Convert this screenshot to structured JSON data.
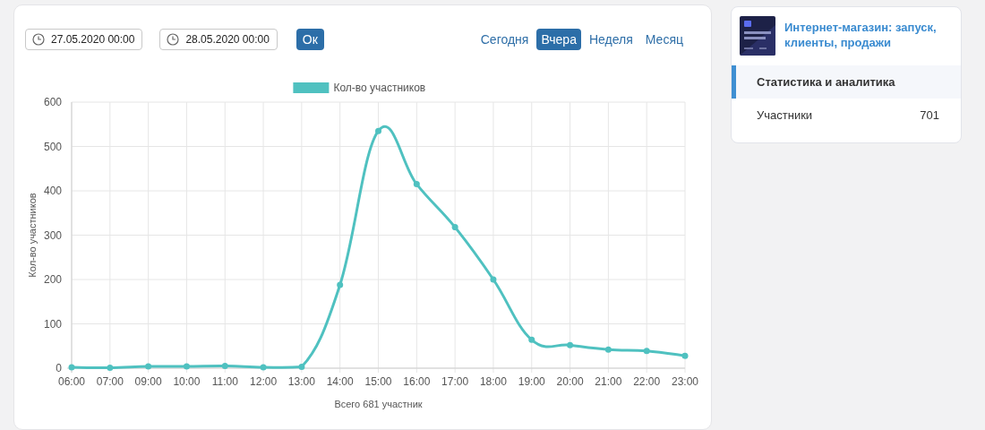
{
  "filters": {
    "date_from": "27.05.2020 00:00",
    "date_to": "28.05.2020 00:00",
    "submit": "Ок"
  },
  "periods": [
    {
      "label": "Сегодня",
      "selected": false
    },
    {
      "label": "Вчера",
      "selected": true
    },
    {
      "label": "Неделя",
      "selected": false
    },
    {
      "label": "Месяц",
      "selected": false
    }
  ],
  "chart_data": {
    "type": "line",
    "xlabel": "Всего 681 участник",
    "ylabel": "Кол-во участников",
    "categories": [
      "06:00",
      "07:00",
      "09:00",
      "10:00",
      "11:00",
      "12:00",
      "13:00",
      "14:00",
      "15:00",
      "16:00",
      "17:00",
      "18:00",
      "19:00",
      "20:00",
      "21:00",
      "22:00",
      "23:00"
    ],
    "grid": true,
    "series": [
      {
        "name": "Кол-во участников",
        "color": "#4fc1c0",
        "marker": true,
        "values": [
          2,
          1,
          4,
          4,
          5,
          2,
          3,
          188,
          535,
          415,
          318,
          200,
          64,
          52,
          42,
          39,
          28
        ]
      }
    ],
    "ylim": [
      0,
      600
    ],
    "yticks": [
      0,
      100,
      200,
      300,
      400,
      500,
      600
    ]
  },
  "course": {
    "title": "Интернет-магазин: запуск, клиенты, продажи"
  },
  "menu": [
    {
      "label": "Статистика и аналитика",
      "selected": true
    },
    {
      "label": "Участники",
      "selected": false,
      "count": "701"
    }
  ]
}
